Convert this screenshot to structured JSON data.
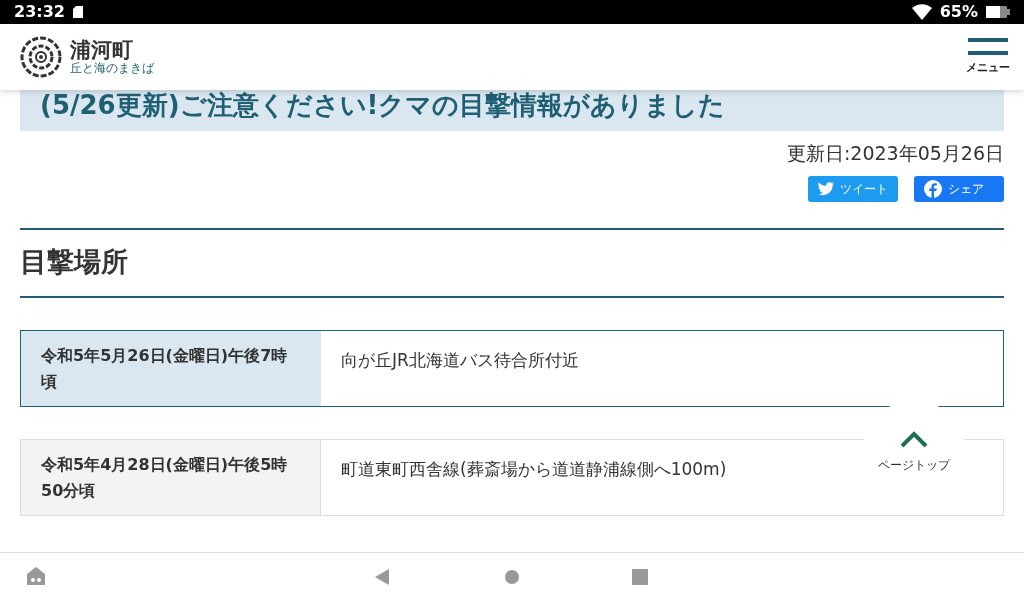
{
  "status_bar": {
    "time": "23:32",
    "battery": "65%"
  },
  "header": {
    "town_name": "浦河町",
    "tagline": "丘と海のまきば",
    "menu_label": "メニュー"
  },
  "article": {
    "title": "(5/26更新)ご注意ください!クマの目撃情報がありました",
    "updated": "更新日:2023年05月26日",
    "share_buttons": [
      {
        "kind": "twitter",
        "label": "ツイート"
      },
      {
        "kind": "facebook",
        "label": "シェア"
      }
    ],
    "section_heading": "目撃場所",
    "sightings": [
      {
        "date": "令和5年5月26日(金曜日)午後7時頃",
        "place": "向が丘JR北海道バス待合所付近",
        "highlighted": true
      },
      {
        "date": "令和5年4月28日(金曜日)午後5時50分頃",
        "place": "町道東町西舎線(葬斎場から道道静浦線側へ100m)",
        "highlighted": false
      }
    ]
  },
  "page_top": {
    "label": "ページトップ"
  }
}
